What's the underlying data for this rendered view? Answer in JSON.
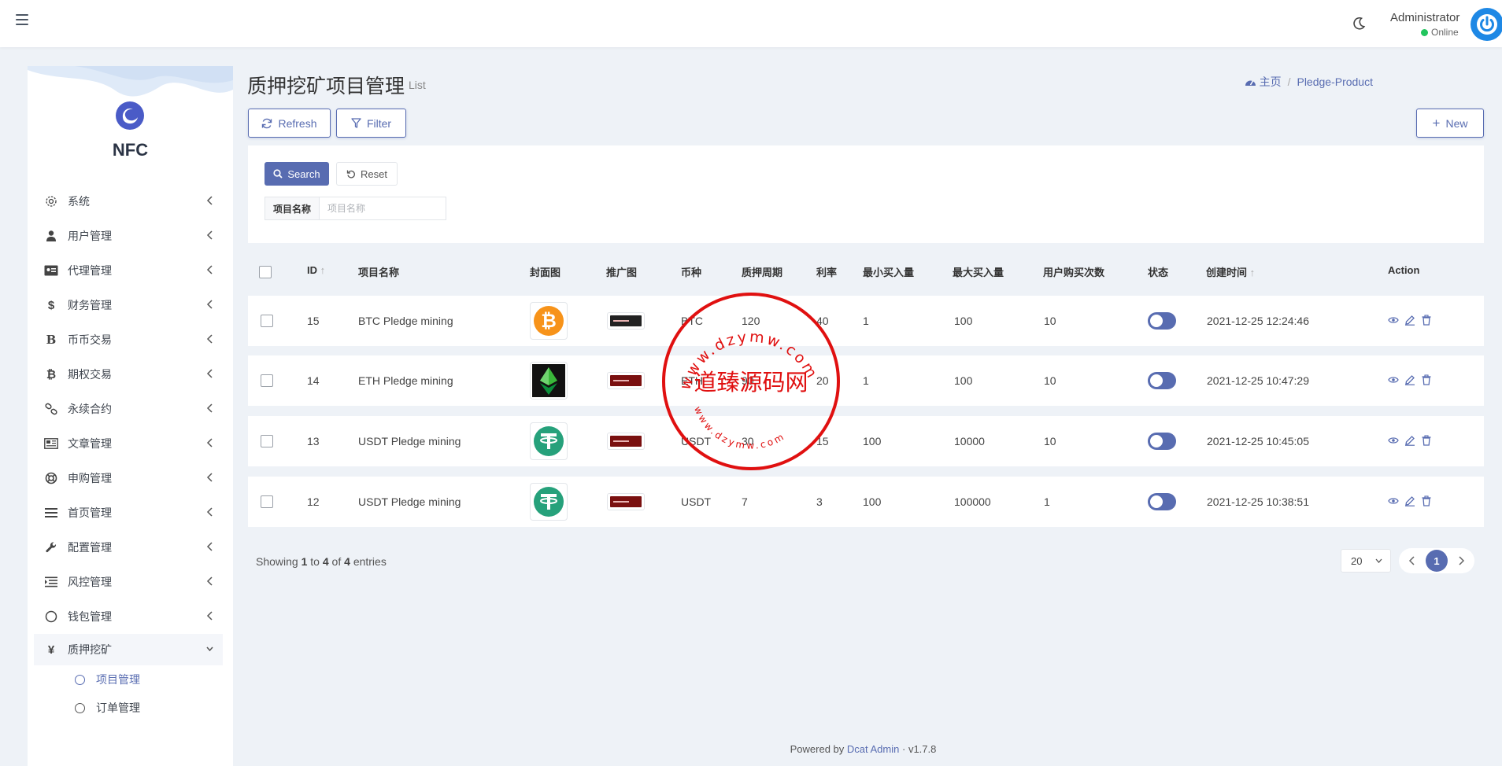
{
  "topbar": {
    "user_name": "Administrator",
    "user_status": "Online"
  },
  "sidebar": {
    "brand": "NFC",
    "items": [
      {
        "label": "系统",
        "icon": "gear-icon"
      },
      {
        "label": "用户管理",
        "icon": "user-tie-icon"
      },
      {
        "label": "代理管理",
        "icon": "id-card-icon"
      },
      {
        "label": "财务管理",
        "icon": "dollar-icon"
      },
      {
        "label": "币币交易",
        "icon": "bold-b-icon"
      },
      {
        "label": "期权交易",
        "icon": "bitcoin-icon"
      },
      {
        "label": "永续合约",
        "icon": "link-icon"
      },
      {
        "label": "文章管理",
        "icon": "newspaper-icon"
      },
      {
        "label": "申购管理",
        "icon": "life-ring-icon"
      },
      {
        "label": "首页管理",
        "icon": "list-icon"
      },
      {
        "label": "配置管理",
        "icon": "wrench-icon"
      },
      {
        "label": "风控管理",
        "icon": "indent-icon"
      },
      {
        "label": "钱包管理",
        "icon": "circle-icon"
      },
      {
        "label": "质押挖矿",
        "icon": "yen-icon"
      }
    ],
    "sub_items": [
      {
        "label": "项目管理"
      },
      {
        "label": "订单管理"
      }
    ]
  },
  "header": {
    "title": "质押挖矿项目管理",
    "subtitle": "List",
    "breadcrumb_home": "主页",
    "breadcrumb_current": "Pledge-Product",
    "refresh_label": "Refresh",
    "filter_label": "Filter",
    "new_label": "New"
  },
  "filter": {
    "search_label": "Search",
    "reset_label": "Reset",
    "field_label": "项目名称",
    "field_placeholder": "项目名称",
    "field_value": ""
  },
  "table": {
    "columns": [
      "ID",
      "项目名称",
      "封面图",
      "推广图",
      "币种",
      "质押周期",
      "利率",
      "最小买入量",
      "最大买入量",
      "用户购买次数",
      "状态",
      "创建时间",
      "Action"
    ],
    "rows": [
      {
        "id": "15",
        "name": "BTC Pledge mining",
        "coin_icon": "bitcoin-coin-icon",
        "currency": "BTC",
        "period": "120",
        "rate": "40",
        "min": "1",
        "max": "100",
        "times": "10",
        "status": true,
        "created": "2021-12-25 12:24:46"
      },
      {
        "id": "14",
        "name": "ETH Pledge mining",
        "coin_icon": "ethereum-coin-icon",
        "currency": "ETH",
        "period": "90",
        "rate": "20",
        "min": "1",
        "max": "100",
        "times": "10",
        "status": true,
        "created": "2021-12-25 10:47:29"
      },
      {
        "id": "13",
        "name": "USDT Pledge mining",
        "coin_icon": "tether-coin-icon",
        "currency": "USDT",
        "period": "30",
        "rate": "15",
        "min": "100",
        "max": "10000",
        "times": "10",
        "status": true,
        "created": "2021-12-25 10:45:05"
      },
      {
        "id": "12",
        "name": "USDT Pledge mining",
        "coin_icon": "tether-coin-icon",
        "currency": "USDT",
        "period": "7",
        "rate": "3",
        "min": "100",
        "max": "100000",
        "times": "1",
        "status": true,
        "created": "2021-12-25 10:38:51"
      }
    ]
  },
  "pagination": {
    "showing_prefix": "Showing",
    "from": "1",
    "to_word": "to",
    "to": "4",
    "of_word": "of",
    "total": "4",
    "entries_word": "entries",
    "per_page": "20",
    "current_page": "1"
  },
  "footer": {
    "powered_prefix": "Powered by",
    "powered_link": "Dcat Admin",
    "version": "v1.7.8"
  },
  "watermark": {
    "center_text": "道臻源码网",
    "top_text": "www.dzymw.com",
    "bottom_text": "www.dzymw.com"
  },
  "colors": {
    "accent": "#586cb1",
    "background": "#eef2f7",
    "stamp": "#e01010",
    "online": "#22c55e"
  }
}
